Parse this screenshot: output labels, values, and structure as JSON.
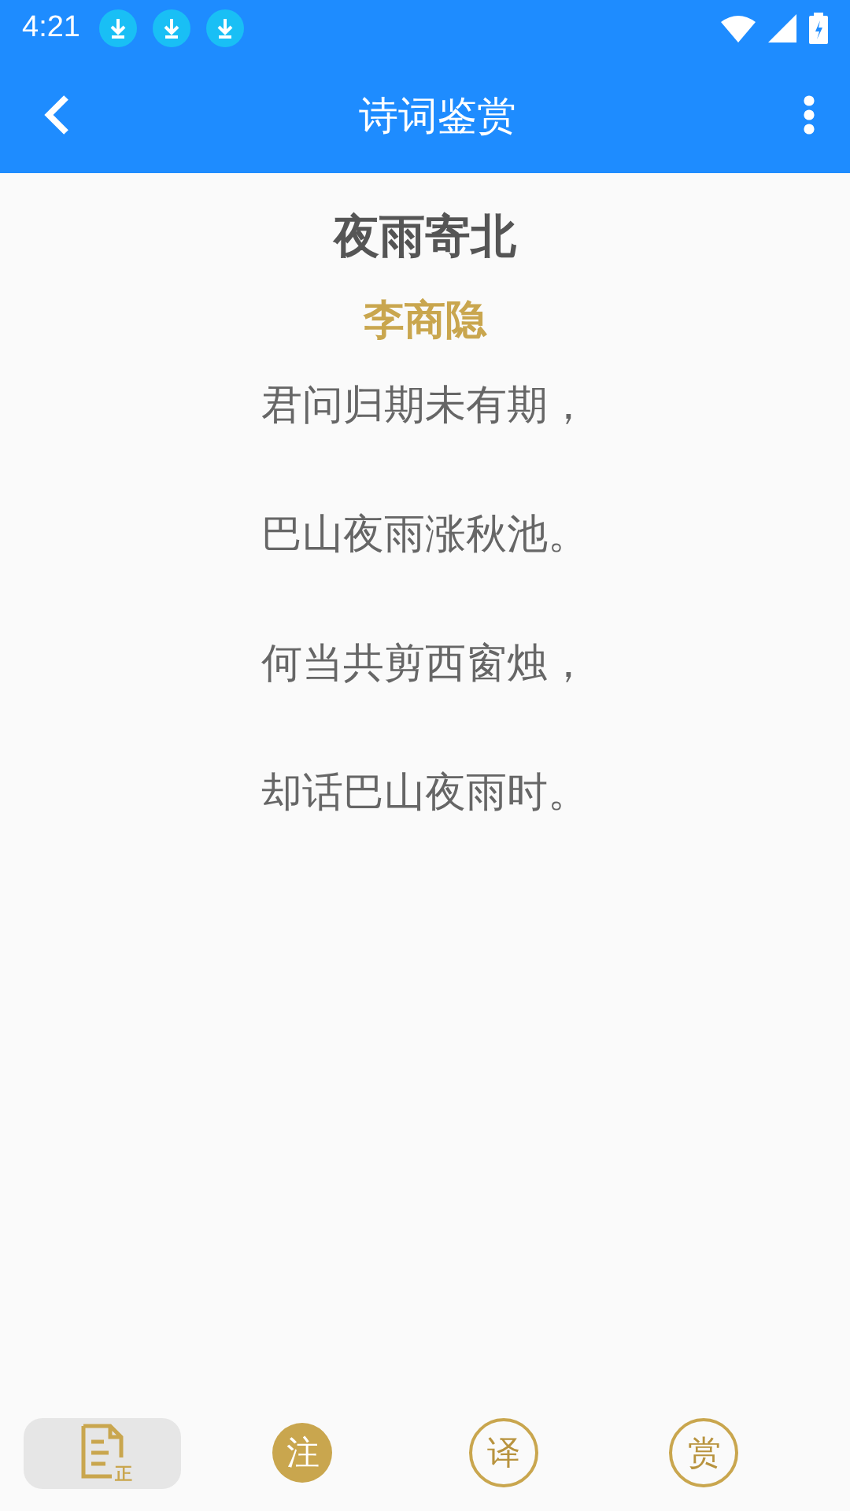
{
  "status_bar": {
    "time": "4:21",
    "notifications": [
      {
        "kind": "download"
      },
      {
        "kind": "download"
      },
      {
        "kind": "download"
      }
    ]
  },
  "app_bar": {
    "title": "诗词鉴赏"
  },
  "poem": {
    "title": "夜雨寄北",
    "author": "李商隐",
    "lines": [
      "君问归期未有期，",
      "巴山夜雨涨秋池。",
      "何当共剪西窗烛，",
      "却话巴山夜雨时。"
    ]
  },
  "bottom_tabs": [
    {
      "kind": "document",
      "label": "正",
      "selected": true
    },
    {
      "kind": "filled",
      "label": "注",
      "selected": false
    },
    {
      "kind": "outline",
      "label": "译",
      "selected": false
    },
    {
      "kind": "outline",
      "label": "赏",
      "selected": false
    }
  ]
}
